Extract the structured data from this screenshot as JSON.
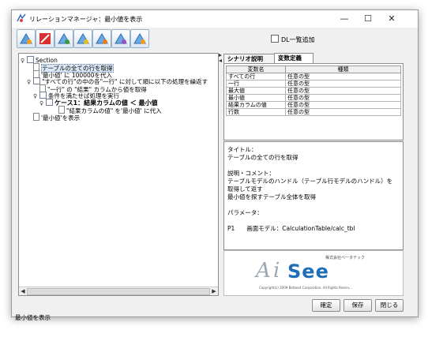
{
  "window": {
    "title": "リレーションマネージャ：最小値を表示",
    "minimize_glyph": "—",
    "maximize_glyph": "☐",
    "close_glyph": "✕"
  },
  "toolbar": {
    "buttons": [
      "play-icon",
      "stop-icon",
      "tool-icon",
      "tool-icon",
      "tool-icon",
      "tool-icon",
      "tool-icon"
    ],
    "dl_list_label": "DL一覧追加"
  },
  "tree": {
    "rows": [
      {
        "label": "Section",
        "twisty": "♀",
        "icon": "folder"
      },
      {
        "label": "テーブルの全ての行を取得",
        "icon": "doc",
        "selected": true
      },
      {
        "label": "'最小値' に 100000を代入",
        "icon": "doc"
      },
      {
        "label": "\"すべての行\"の中の各\"一行\" に対して順に以下の処理を繰返す",
        "twisty": "♀",
        "icon": "folder"
      },
      {
        "label": "\"一行\" の \"結果\" カラムから値を取得",
        "icon": "doc"
      },
      {
        "label": "条件を満たせば処理を実行",
        "twisty": "♀",
        "icon": "folder"
      },
      {
        "label": "ケース1：結果カラムの値 ＜ 最小値",
        "twisty": "♀",
        "icon": "folder",
        "bold": true
      },
      {
        "label": "\"結果カラムの値\" を'最小値' に代入",
        "icon": "doc"
      },
      {
        "label": "'最小値'を表示",
        "icon": "doc"
      }
    ],
    "scroll_left": "◀",
    "scroll_right": "▶"
  },
  "tabs": [
    "シナリオ説明",
    "変数定義"
  ],
  "params": {
    "headers": [
      "変数名",
      "種類"
    ],
    "rows": [
      [
        "すべての行",
        "任意の型"
      ],
      [
        "一行",
        "任意の型"
      ],
      [
        "最大値",
        "任意の型"
      ],
      [
        "最小値",
        "任意の型"
      ],
      [
        "結果カラムの値",
        "任意の型"
      ],
      [
        "行数",
        "任意の型"
      ]
    ]
  },
  "description": {
    "lines": [
      "タイトル：",
      "テーブルの全ての行を取得",
      "",
      "説明・コメント：",
      "テーブルモデルのハンドル（テーブル行モデルのハンドル）を",
      "取得して返す",
      "最小値を探すテーブル全体を取得",
      "",
      "パラメータ：",
      "",
      "P1　　画面モデル：CalculationTable/calc_tbl"
    ]
  },
  "logo": {
    "company_small": "株式会社ベータテック",
    "brand_a": "A",
    "brand_i": "i",
    "brand_rest": "See",
    "copyright": "Copyright(c) 2009 Betanet Corporation. All Rights Reserv..."
  },
  "buttons": {
    "confirm": "確定",
    "save": "保存",
    "close": "閉じる"
  },
  "status": {
    "text": "最小値を表示"
  }
}
